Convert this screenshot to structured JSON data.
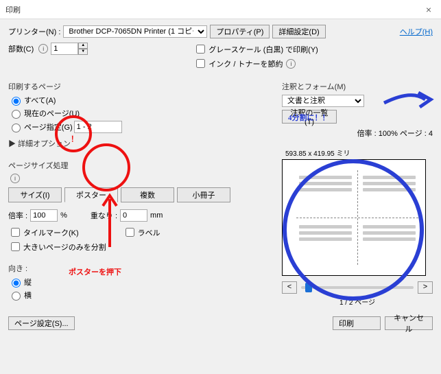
{
  "window": {
    "title": "印刷"
  },
  "printer_row": {
    "label": "プリンター(N) :",
    "selected": "Brother DCP-7065DN Printer (1 コピー)",
    "properties_btn": "プロパティ(P)",
    "advanced_btn": "詳細設定(D)",
    "help": "ヘルプ(H)"
  },
  "copies": {
    "label": "部数(C)",
    "value": "1"
  },
  "print_opts": {
    "grayscale": "グレースケール (白黒) で印刷(Y)",
    "save_toner": "インク / トナーを節約"
  },
  "pages_group": {
    "title": "印刷するページ",
    "all": "すべて(A)",
    "current": "現在のページ(U)",
    "range": "ページ指定(G)",
    "range_value": "1 - 2",
    "more": "▶  詳細オプション"
  },
  "annotations_group": {
    "title": "注釈とフォーム(M)",
    "selected": "文書と注釈",
    "summary_btn": "注釈の一覧(T)",
    "scale_info": "倍率 : 100% ページ : 4"
  },
  "size_group": {
    "title": "ページサイズ処理",
    "tabs": {
      "size": "サイズ(I)",
      "poster": "ポスター",
      "multi": "複数",
      "booklet": "小冊子"
    },
    "scale_label": "倍率 :",
    "scale_value": "100",
    "scale_pct": "%",
    "overlap_label": "重なり :",
    "overlap_value": "0",
    "overlap_unit": "mm",
    "tilemarks": "タイルマーク(K)",
    "labels": "ラベル",
    "large_only": "大きいページのみを分割"
  },
  "orientation": {
    "title": "向き :",
    "portrait": "縦",
    "landscape": "横"
  },
  "preview": {
    "dims": "593.85 x 419.95 ミリ",
    "page_indicator": "1 / 2 ページ"
  },
  "footer": {
    "page_setup": "ページ設定(S)...",
    "print": "印刷",
    "cancel": "キャンセル"
  },
  "hand_annotations": {
    "red_top": "！",
    "red_bottom": "ポスターを押下",
    "blue": "4分割に！！"
  },
  "underline_key": "⓪"
}
